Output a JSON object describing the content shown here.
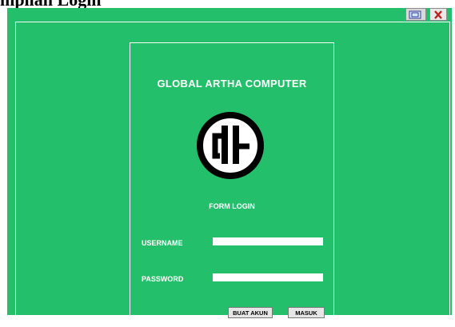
{
  "heading": "mpilan Login",
  "window": {
    "icons": [
      "restore-window-icon",
      "close-icon"
    ]
  },
  "login": {
    "company_name": "GLOBAL ARTHA COMPUTER",
    "form_title": "FORM LOGIN",
    "username_label": "USERNAME",
    "username_value": "",
    "password_label": "PASSWORD",
    "password_value": "",
    "register_button": "BUAT AKUN",
    "login_button": "MASUK"
  },
  "colors": {
    "window_background": "#23bf6a",
    "text": "#ffffff",
    "input_background": "#ffffff",
    "button_background": "#e6e6e6"
  }
}
